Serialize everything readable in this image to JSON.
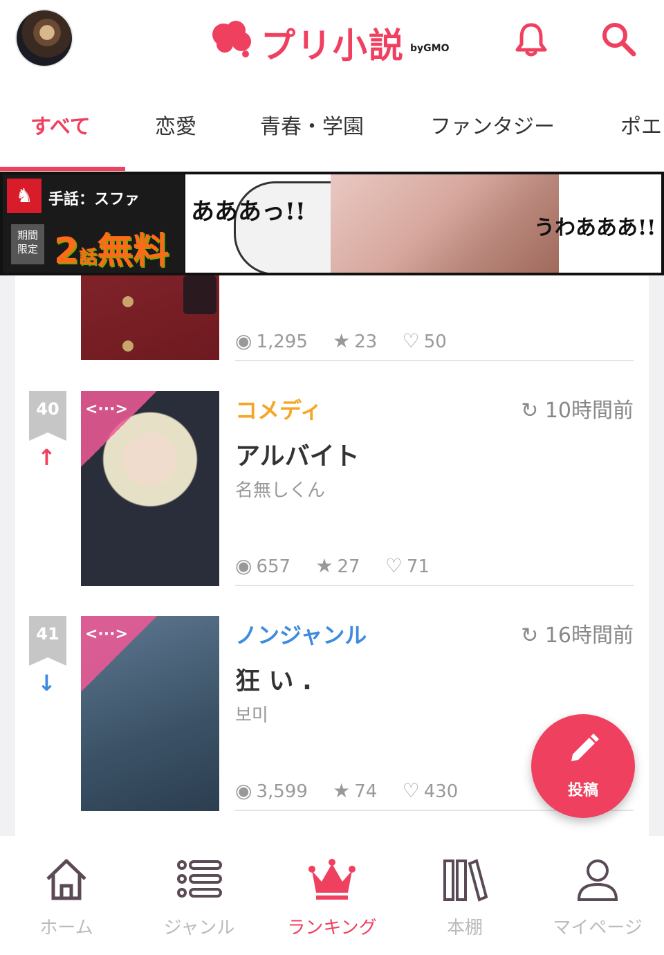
{
  "header": {
    "logo_text": "プリ小説",
    "logo_sub": "byGMO",
    "avatar_icon": "user-avatar",
    "notification_icon": "bell-icon",
    "search_icon": "search-icon",
    "brand_color": "#f04060"
  },
  "tabs": [
    {
      "label": "すべて",
      "active": true
    },
    {
      "label": "恋愛"
    },
    {
      "label": "青春・学園"
    },
    {
      "label": "ファンタジー"
    },
    {
      "label": "ポエ"
    }
  ],
  "ad": {
    "series": "手話：スファ",
    "limited": "期間\n限定",
    "free_num": "2",
    "free_unit": "話",
    "free_text": "無料",
    "speech_left": "あああっ!!",
    "speech_right": "うわあああ!!"
  },
  "stories": [
    {
      "views": "1,295",
      "stars": "23",
      "likes": "50"
    },
    {
      "rank": "40",
      "trend": "up",
      "genre": "コメディ",
      "genre_color": "#f5a623",
      "time": "10時間前",
      "title": "アルバイト",
      "author": "名無しくん",
      "badge": "<···>",
      "views": "657",
      "stars": "27",
      "likes": "71"
    },
    {
      "rank": "41",
      "trend": "down",
      "genre": "ノンジャンル",
      "genre_color": "#3e8bdf",
      "time": "16時間前",
      "title": "狂 い .",
      "author": "보미",
      "badge": "<···>",
      "views": "3,599",
      "stars": "74",
      "likes": "430"
    }
  ],
  "fab": {
    "label": "投稿",
    "icon": "pencil-icon"
  },
  "nav": [
    {
      "label": "ホーム",
      "icon": "home-icon"
    },
    {
      "label": "ジャンル",
      "icon": "list-icon"
    },
    {
      "label": "ランキング",
      "icon": "crown-icon",
      "active": true
    },
    {
      "label": "本棚",
      "icon": "bookshelf-icon"
    },
    {
      "label": "マイページ",
      "icon": "person-icon"
    }
  ]
}
